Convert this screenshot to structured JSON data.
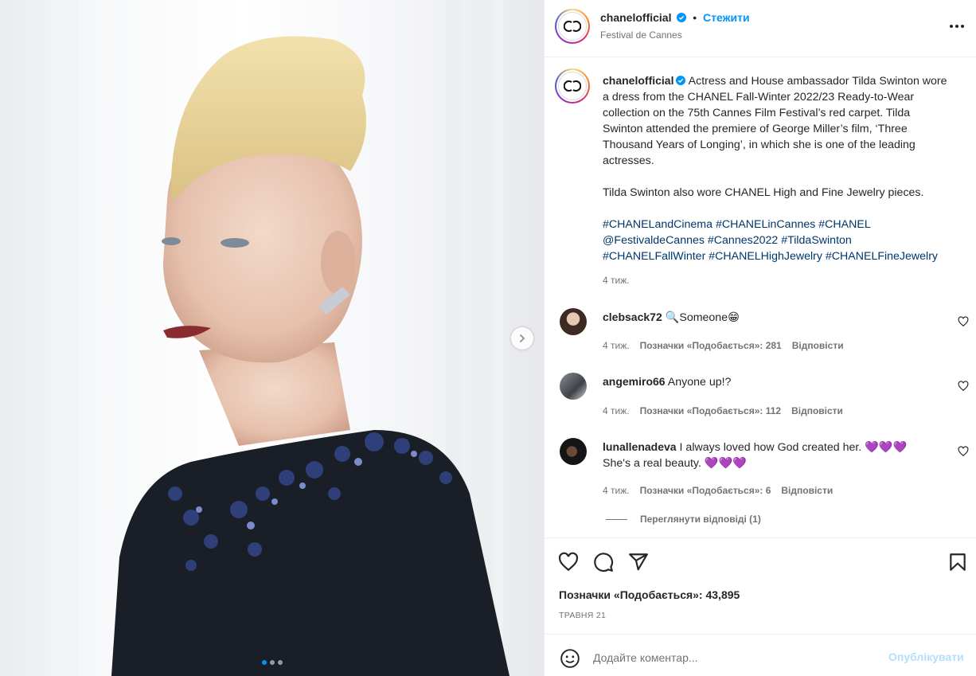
{
  "post": {
    "account": {
      "username": "chanelofficial",
      "verified": true,
      "follow_label": "Стежити",
      "location": "Festival de Cannes",
      "separator": "•"
    },
    "media": {
      "slide_count": 3,
      "active_slide": 1,
      "next_icon": "chevron-right-icon"
    },
    "caption": {
      "username": "chanelofficial",
      "paragraph1": "Actress and House ambassador Tilda Swinton wore a dress from the CHANEL Fall-Winter 2022/23 Ready-to-Wear collection on the 75th Cannes Film Festival’s red carpet. Tilda Swinton attended the premiere of George Miller’s film, ‘Three Thousand Years of Longing’, in which she is one of the leading actresses.",
      "paragraph2": "Tilda Swinton also wore CHANEL High and Fine Jewelry pieces.",
      "hashtags_line1": "#CHANELandCinema #CHANELinCannes #CHANEL",
      "hashtags_line2": "@FestivaldeCannes #Cannes2022 #TildaSwinton",
      "hashtags_line3": "#CHANELFallWinter #CHANELHighJewelry #CHANELFineJewelry",
      "time": "4 тиж."
    },
    "comments": [
      {
        "username": "clebsack72",
        "text": "🔍Someone😁",
        "time": "4 тиж.",
        "likes": "Позначки «Подобається»: 281",
        "reply": "Відповісти"
      },
      {
        "username": "angemiro66",
        "text": "Anyone up!?",
        "time": "4 тиж.",
        "likes": "Позначки «Подобається»: 112",
        "reply": "Відповісти"
      },
      {
        "username": "lunallenadeva",
        "text": "I always loved how God created her. 💜💜💜",
        "text_line2": "She's a real beauty. 💜💜💜",
        "time": "4 тиж.",
        "likes": "Позначки «Подобається»: 6",
        "reply": "Відповісти"
      }
    ],
    "view_replies": "Переглянути відповіді (1)",
    "likes_total": "Позначки «Подобається»: 43,895",
    "date": "Травня 21",
    "add_comment": {
      "placeholder": "Додайте коментар...",
      "post_label": "Опублікувати"
    },
    "icons": [
      "heart-icon",
      "comment-icon",
      "share-icon",
      "bookmark-icon",
      "emoji-icon",
      "more-icon",
      "verified-icon"
    ]
  },
  "colors": {
    "accent": "#0095f6",
    "link": "#00376b",
    "text": "#262626",
    "muted": "#737373",
    "post_disabled": "#b2dffc"
  }
}
